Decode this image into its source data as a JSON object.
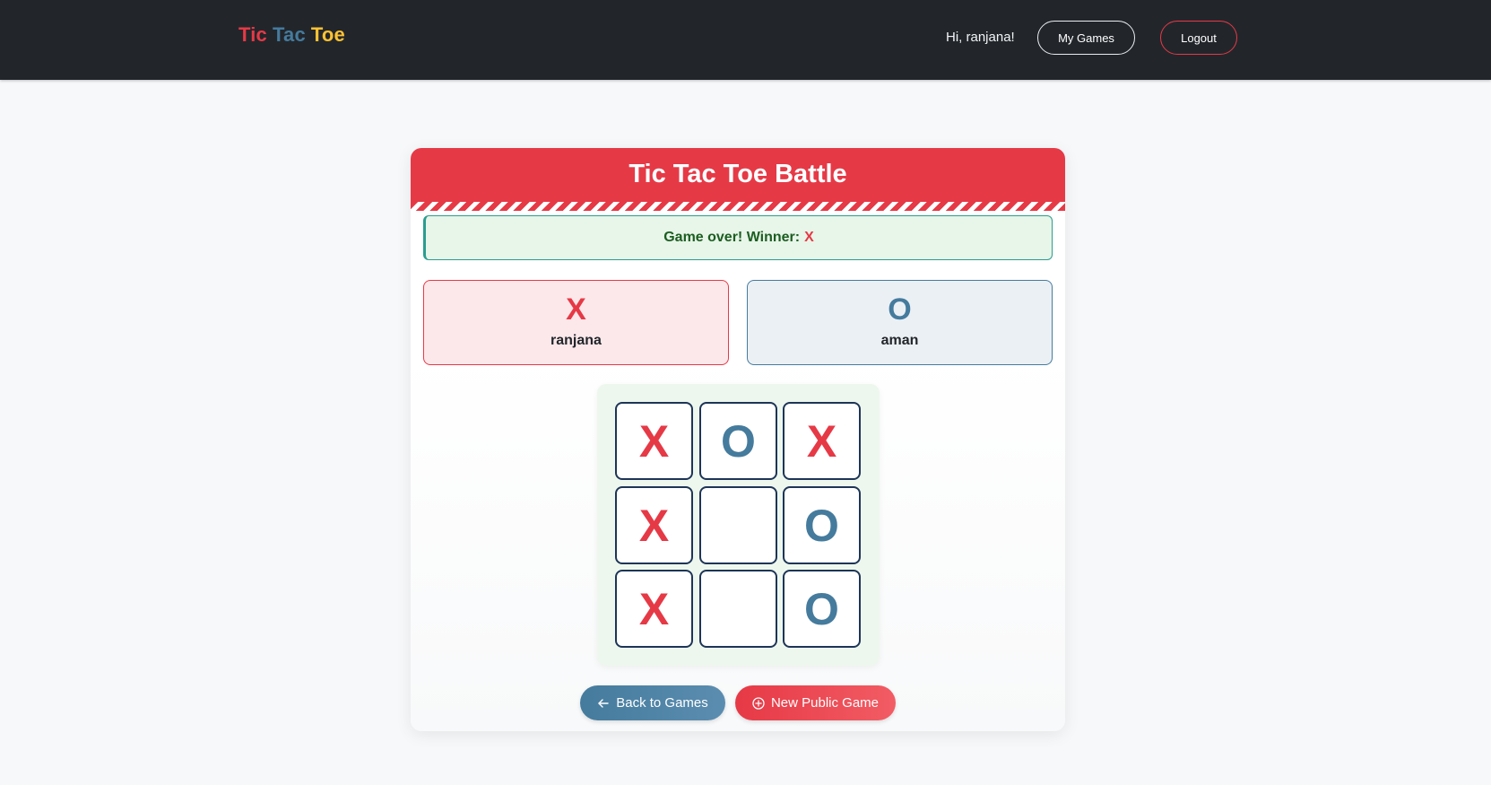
{
  "navbar": {
    "brand": {
      "word1": "Tic",
      "word2": "Tac",
      "word3": "Toe"
    },
    "greeting": "Hi, ranjana!",
    "my_games_label": "My Games",
    "logout_label": "Logout"
  },
  "game": {
    "title": "Tic Tac Toe Battle",
    "status_text": "Game over! Winner:",
    "winner": "X",
    "players": [
      {
        "symbol": "X",
        "name": "ranjana"
      },
      {
        "symbol": "O",
        "name": "aman"
      }
    ],
    "board": [
      "X",
      "O",
      "X",
      "X",
      "",
      "O",
      "X",
      "",
      "O"
    ]
  },
  "actions": {
    "back_label": "Back to Games",
    "back_icon": "arrow-left-icon",
    "new_label": "New Public Game",
    "new_icon": "plus-circle-icon"
  },
  "colors": {
    "navbar_bg": "#22262b",
    "accent_red": "#e63946",
    "accent_blue": "#457b9d",
    "accent_yellow": "#ffc233",
    "status_bg": "#e8f5e9",
    "status_border": "#2a9d8f",
    "cell_border": "#1d3557"
  }
}
